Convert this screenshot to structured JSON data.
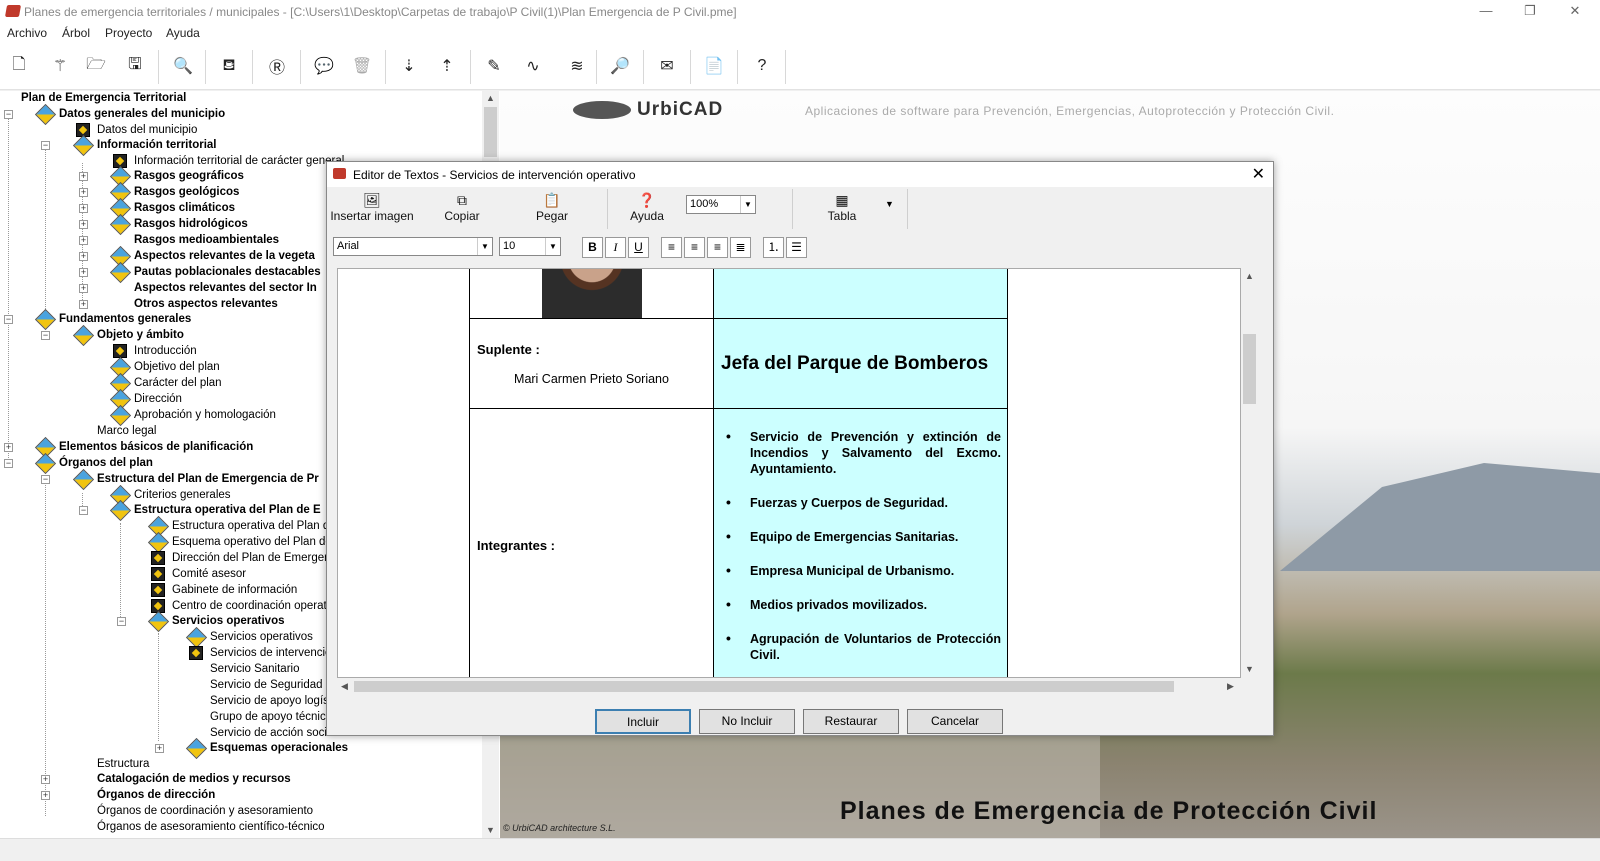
{
  "window": {
    "title": "Planes de emergencia territoriales / municipales - [C:\\Users\\1\\Desktop\\Carpetas de trabajo\\P Civil(1)\\Plan Emergencia de P Civil.pme]",
    "minimize": "—",
    "restore": "❐",
    "close": "✕"
  },
  "menu": [
    "Archivo",
    "Árbol",
    "Proyecto",
    "Ayuda"
  ],
  "toolbar_icons": [
    "new-file",
    "magic-wand",
    "open-folder",
    "save",
    "preview",
    "binoculars",
    "report",
    "comment",
    "trash",
    "sort-descending",
    "sort-ascending",
    "pencil",
    "waveform",
    "waves",
    "search-document",
    "envelope",
    "pdf",
    "help"
  ],
  "tree": {
    "root": "Plan de Emergencia Territorial",
    "items": [
      "Datos generales del municipio",
      "Datos del municipio",
      "Información territorial",
      "Información territorial de carácter general",
      "Rasgos geográficos",
      "Rasgos geológicos",
      "Rasgos climáticos",
      "Rasgos hidrológicos",
      "Rasgos medioambientales",
      "Aspectos relevantes de la vegeta",
      "Pautas poblacionales destacables",
      "Aspectos relevantes del sector In",
      "Otros aspectos relevantes",
      "Fundamentos generales",
      "Objeto y ámbito",
      "Introducción",
      "Objetivo del plan",
      "Carácter del plan",
      "Dirección",
      "Aprobación y homologación",
      "Marco legal",
      "Elementos básicos de planificación",
      "Órganos del plan",
      "Estructura del Plan de Emergencia de Pr",
      "Criterios generales",
      "Estructura operativa del Plan de E",
      "Estructura operativa del Plan de",
      "Esquema operativo del Plan de E",
      "Dirección del Plan de Emergenc",
      "Comité asesor",
      "Gabinete de información",
      "Centro de coordinación operativ",
      "Servicios operativos",
      "Servicios operativos",
      "Servicios de intervención",
      "Servicio Sanitario",
      "Servicio de Seguridad",
      "Servicio de apoyo logíst",
      "Grupo de apoyo técnico",
      "Servicio de acción social",
      "Esquemas operacionales",
      "Estructura",
      "Catalogación de medios y recursos",
      "Órganos de dirección",
      "Órganos de coordinación y asesoramiento",
      "Órganos de asesoramiento científico-técnico"
    ]
  },
  "background": {
    "logo": "UrbiCAD",
    "tagline": "Aplicaciones de software para Prevención, Emergencias, Autoprotección y Protección Civil.",
    "title": "Planes de Emergencia de Protección Civil",
    "copyright": "© UrbiCAD architecture S.L."
  },
  "dialog": {
    "title": "Editor de Textos - Servicios de intervención operativo",
    "toolbar": {
      "insert_image": "Insertar imagen",
      "copy": "Copiar",
      "paste": "Pegar",
      "help": "Ayuda",
      "zoom": "100%",
      "table": "Tabla"
    },
    "format": {
      "font": "Arial",
      "size": "10",
      "bold": "B",
      "italic": "I",
      "underline": "U"
    },
    "document": {
      "suplente_label": "Suplente :",
      "suplente_name": "Mari Carmen Prieto Soriano",
      "role": "Jefa del Parque de Bomberos",
      "integrantes_label": "Integrantes :",
      "integrantes": [
        "Servicio de Prevención y extinción de Incendios y Salvamento del Excmo. Ayuntamiento.",
        "Fuerzas y Cuerpos de Seguridad.",
        "Equipo de Emergencias Sanitarias.",
        "Empresa Municipal de Urbanismo.",
        "Medios privados movilizados.",
        "Agrupación de Voluntarios de Protección Civil."
      ]
    },
    "buttons": {
      "include": "Incluir",
      "exclude": "No Incluir",
      "restore": "Restaurar",
      "cancel": "Cancelar"
    }
  }
}
